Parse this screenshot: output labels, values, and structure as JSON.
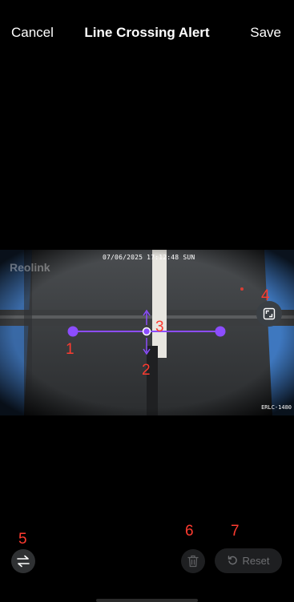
{
  "nav": {
    "cancel": "Cancel",
    "title": "Line Crossing Alert",
    "save": "Save"
  },
  "video": {
    "timestamp": "07/06/2025 17:12:48 SUN",
    "brand": "Reolink",
    "model": "ERLC-1480"
  },
  "line": {
    "color": "#8c4dff"
  },
  "annotations": {
    "a1": "1",
    "a2": "2",
    "a3": "3",
    "a4": "4",
    "a5": "5",
    "a6": "6",
    "a7": "7"
  },
  "toolbar": {
    "reset_label": "Reset"
  },
  "colors": {
    "accent": "#8c4dff",
    "annotation": "#ff3b30"
  }
}
